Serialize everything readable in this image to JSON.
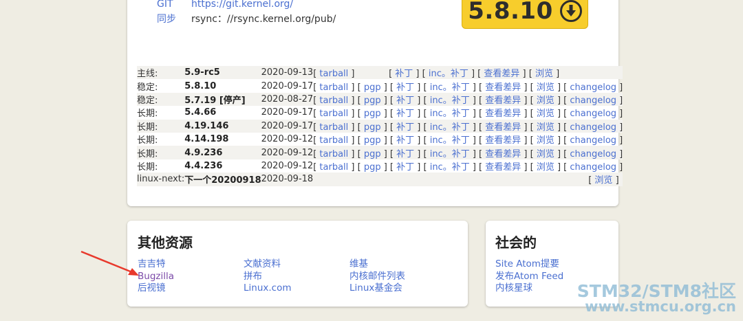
{
  "mirrors": [
    {
      "key": "GIT",
      "value": "https://git.kernel.org/"
    },
    {
      "key": "同步",
      "value": "rsync：//rsync.kernel.org/pub/"
    }
  ],
  "download": {
    "version": "5.8.10"
  },
  "releases": [
    {
      "branch": "主线:",
      "version": "5.9-rc5",
      "date": "2020-09-13",
      "links": "[ tarball ]            [ 补丁 ] [ inc。补丁 ] [ 查看差异 ] [ 浏览 ]"
    },
    {
      "branch": "稳定:",
      "version": "5.8.10",
      "date": "2020-09-17",
      "links": "[ tarball ] [ pgp ] [ 补丁 ] [ inc。补丁 ] [ 查看差异 ] [ 浏览 ] [ changelog ]"
    },
    {
      "branch": "稳定:",
      "version": "5.7.19 [停产]",
      "date": "2020-08-27",
      "links": "[ tarball ] [ pgp ] [ 补丁 ] [ inc。补丁 ] [ 查看差异 ] [ 浏览 ] [ changelog ]"
    },
    {
      "branch": "长期:",
      "version": "5.4.66",
      "date": "2020-09-17",
      "links": "[ tarball ] [ pgp ] [ 补丁 ] [ inc。补丁 ] [ 查看差异 ] [ 浏览 ] [ changelog ]"
    },
    {
      "branch": "长期:",
      "version": "4.19.146",
      "date": "2020-09-17",
      "links": "[ tarball ] [ pgp ] [ 补丁 ] [ inc。补丁 ] [ 查看差异 ] [ 浏览 ] [ changelog ]"
    },
    {
      "branch": "长期:",
      "version": "4.14.198",
      "date": "2020-09-12",
      "links": "[ tarball ] [ pgp ] [ 补丁 ] [ inc。补丁 ] [ 查看差异 ] [ 浏览 ] [ changelog ]"
    },
    {
      "branch": "长期:",
      "version": "4.9.236",
      "date": "2020-09-12",
      "links": "[ tarball ] [ pgp ] [ 补丁 ] [ inc。补丁 ] [ 查看差异 ] [ 浏览 ] [ changelog ]"
    },
    {
      "branch": "长期:",
      "version": "4.4.236",
      "date": "2020-09-12",
      "links": "[ tarball ] [ pgp ] [ 补丁 ] [ inc。补丁 ] [ 查看差异 ] [ 浏览 ] [ changelog ]"
    },
    {
      "branch": "linux-next:",
      "version": "下一个20200918",
      "date": "2020-09-18",
      "links": "[ 浏览 ]"
    }
  ],
  "other_resources": {
    "title": "其他资源",
    "col1": [
      "吉吉特",
      "Bugzilla",
      "后视镜"
    ],
    "col2": [
      "文献资料",
      "拼布",
      "Linux.com"
    ],
    "col3": [
      "维基",
      "内核邮件列表",
      "Linux基金会"
    ]
  },
  "social": {
    "title": "社会的",
    "items": [
      "Site Atom提要",
      "发布Atom Feed",
      "内核星球"
    ]
  },
  "watermark": {
    "line1": "STM32/STM8社区",
    "line2": "www.stmcu.org.cn"
  },
  "colors": {
    "link": "#4a6fd0",
    "button": "#f7cd2c",
    "arrow": "#e8392c"
  }
}
